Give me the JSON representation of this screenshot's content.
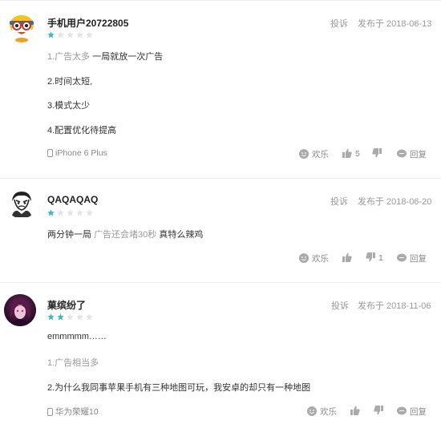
{
  "colors": {
    "star_on": "#3cb6c0",
    "star_off": "#e3e3e3",
    "muted": "#999999"
  },
  "reviews": [
    {
      "username": "手机用户20722805",
      "report": "投诉",
      "date": "发布于 2018-06-13",
      "rating": 1,
      "lines": [
        {
          "tag": "1.广告太多",
          "text": " 一局就放一次广告"
        },
        {
          "tag": "",
          "text": "2.时间太短,"
        },
        {
          "tag": "",
          "text": "3.模式太少"
        },
        {
          "tag": "",
          "text": "4.配置优化待提高"
        }
      ],
      "device": "iPhone 6 Plus",
      "actions": {
        "fun": "欢乐",
        "like": "5",
        "dislike": "",
        "reply": "回复"
      }
    },
    {
      "username": "QAQAQAQ",
      "report": "投诉",
      "date": "发布于 2018-06-20",
      "rating": 1,
      "line_parts": [
        "两分钟一局 ",
        "广告还会堵30秒",
        " 真特么辣鸡"
      ],
      "device": "",
      "actions": {
        "fun": "欢乐",
        "like": "",
        "dislike": "1",
        "reply": "回复"
      }
    },
    {
      "username": "菓缤纷了",
      "report": "投诉",
      "date": "发布于 2018-11-06",
      "rating": 2,
      "lines": [
        {
          "tag": "",
          "text": "emmmmm……"
        },
        {
          "tag": "1.广告相当多",
          "text": ""
        },
        {
          "tag": "",
          "text": "2.为什么我同事苹果手机有三种地图可玩，我安卓的却只有一种地图"
        }
      ],
      "device": "华为荣耀10",
      "actions": {
        "fun": "欢乐",
        "like": "",
        "dislike": "",
        "reply": "回复"
      }
    }
  ]
}
